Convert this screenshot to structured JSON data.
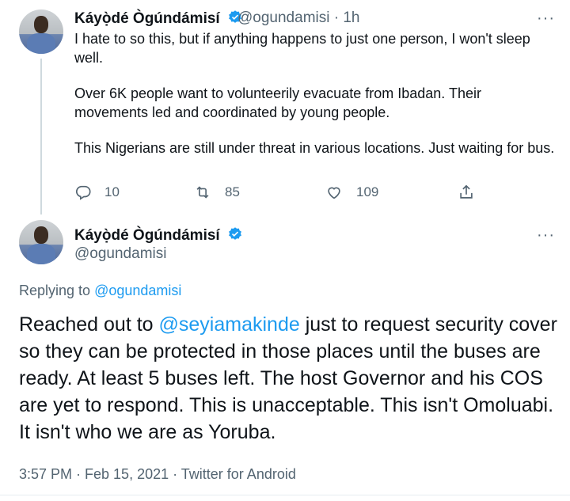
{
  "colors": {
    "accent": "#1d9bf0",
    "text": "#0f1419",
    "muted": "#536471"
  },
  "tweet1": {
    "author_name": "Káyọ̀dé Ògúndámisí",
    "handle": "@ogundamisi",
    "time": "· 1h",
    "paragraphs": [
      "I hate to so this, but if anything happens to just one person, I won't sleep well.",
      "Over 6K people want to volunteerily evacuate from Ibadan. Their movements led and coordinated by young people.",
      "This Nigerians are still under threat in various locations. Just waiting for bus."
    ],
    "replies": "10",
    "retweets": "85",
    "likes": "109",
    "icons": {
      "reply": "reply-icon",
      "retweet": "retweet-icon",
      "like": "heart-icon",
      "share": "share-icon",
      "more": "more-icon",
      "verified": "verified-badge-icon"
    }
  },
  "tweet2": {
    "author_name": "Káyọ̀dé Ògúndámisí",
    "handle": "@ogundamisi",
    "replying_prefix": "Replying to",
    "replying_to": "@ogundamisi",
    "text_before": "Reached out to ",
    "mention": "@seyiamakinde",
    "text_after": " just to request security cover so they can be protected in those places until the buses are ready. At least 5 buses left. The host Governor and his COS are yet to respond. This is unacceptable. This isn't Omoluabi. It isn't who we are as Yoruba.",
    "timestamp": "3:57 PM · Feb 15, 2021 · Twitter for Android"
  }
}
